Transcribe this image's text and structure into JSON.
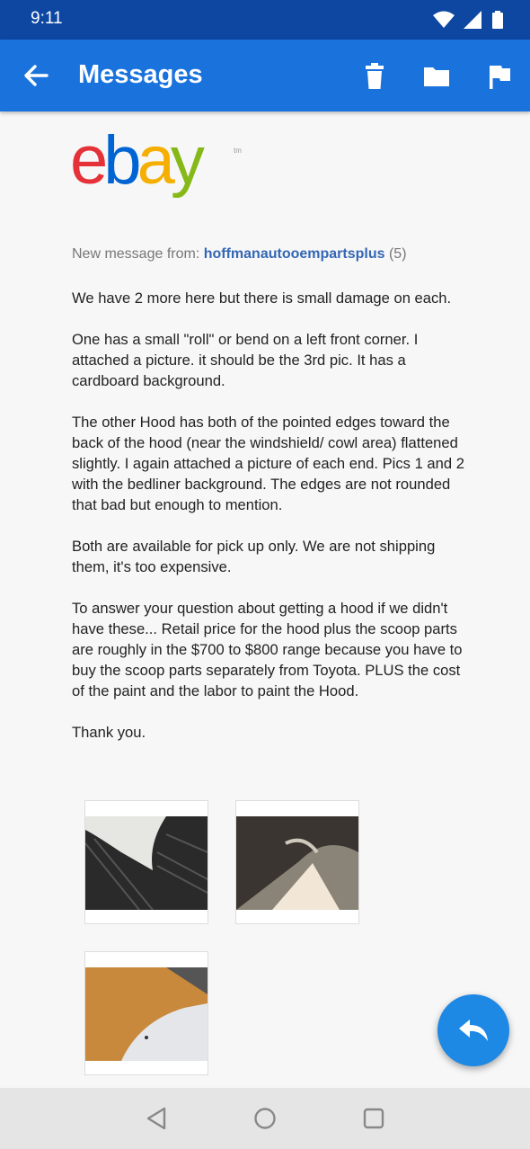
{
  "status_bar": {
    "time": "9:11",
    "icons": [
      "wifi-icon",
      "signal-icon",
      "battery-icon"
    ]
  },
  "app_bar": {
    "title": "Messages",
    "actions": [
      "trash-icon",
      "folder-icon",
      "flag-icon"
    ],
    "back_icon": "arrow-left-icon"
  },
  "logo": {
    "text": "ebay",
    "trademark": "tm",
    "letter_colors": [
      "#e53238",
      "#0064d2",
      "#f5af02",
      "#86b817"
    ]
  },
  "message": {
    "from_label": "New message from:",
    "sender": "hoffmanautooempartsplus",
    "feedback": "(5)",
    "paragraphs": [
      "We have 2 more here but there is small damage on each.",
      "One has a small \"roll\" or bend on a left front corner. I attached a picture. it should be the 3rd pic. It has a cardboard background.",
      "The other Hood has both of the pointed edges toward the back of the hood (near the windshield/ cowl area) flattened slightly. I again attached a picture of each end. Pics 1 and 2 with the bedliner background. The edges are not rounded that bad but enough to mention.",
      "Both are available for pick up only. We are not shipping them, it's too expensive.",
      "To answer your question about getting a hood if we didn't have these... Retail price for the hood plus the scoop parts are roughly in the $700 to $800 range because you have to buy the scoop parts separately from Toyota. PLUS the cost of the paint and the labor to paint the Hood.",
      "Thank you."
    ]
  },
  "attachments": [
    "photo-1",
    "photo-2",
    "photo-3"
  ],
  "fab": {
    "icon": "reply-icon"
  },
  "nav_bar": {
    "buttons": [
      "back-triangle-icon",
      "home-circle-icon",
      "recents-square-icon"
    ]
  }
}
